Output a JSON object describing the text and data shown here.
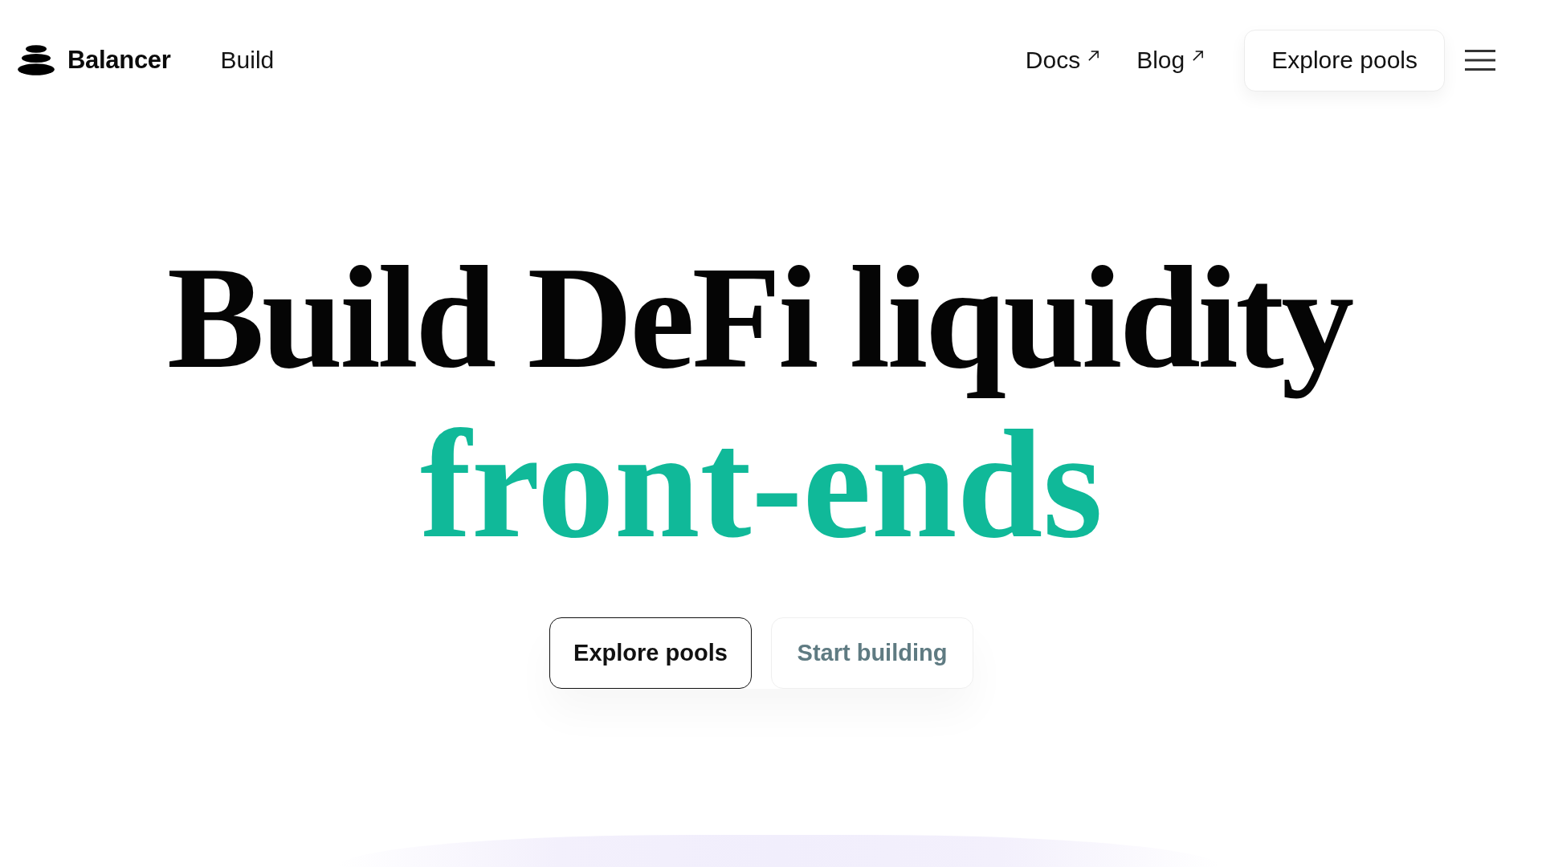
{
  "header": {
    "logo": {
      "name": "Balancer"
    },
    "nav_left": [
      {
        "label": "Build"
      }
    ],
    "nav_right": [
      {
        "label": "Docs",
        "external": true
      },
      {
        "label": "Blog",
        "external": true
      }
    ],
    "cta": {
      "label": "Explore pools"
    }
  },
  "hero": {
    "title_lines": [
      {
        "text": "Build DeFi liquidity",
        "accent": false
      },
      {
        "text": "front-ends",
        "accent": true
      }
    ],
    "buttons": [
      {
        "label": "Explore pools",
        "kind": "primary"
      },
      {
        "label": "Start building",
        "kind": "secondary"
      }
    ]
  }
}
